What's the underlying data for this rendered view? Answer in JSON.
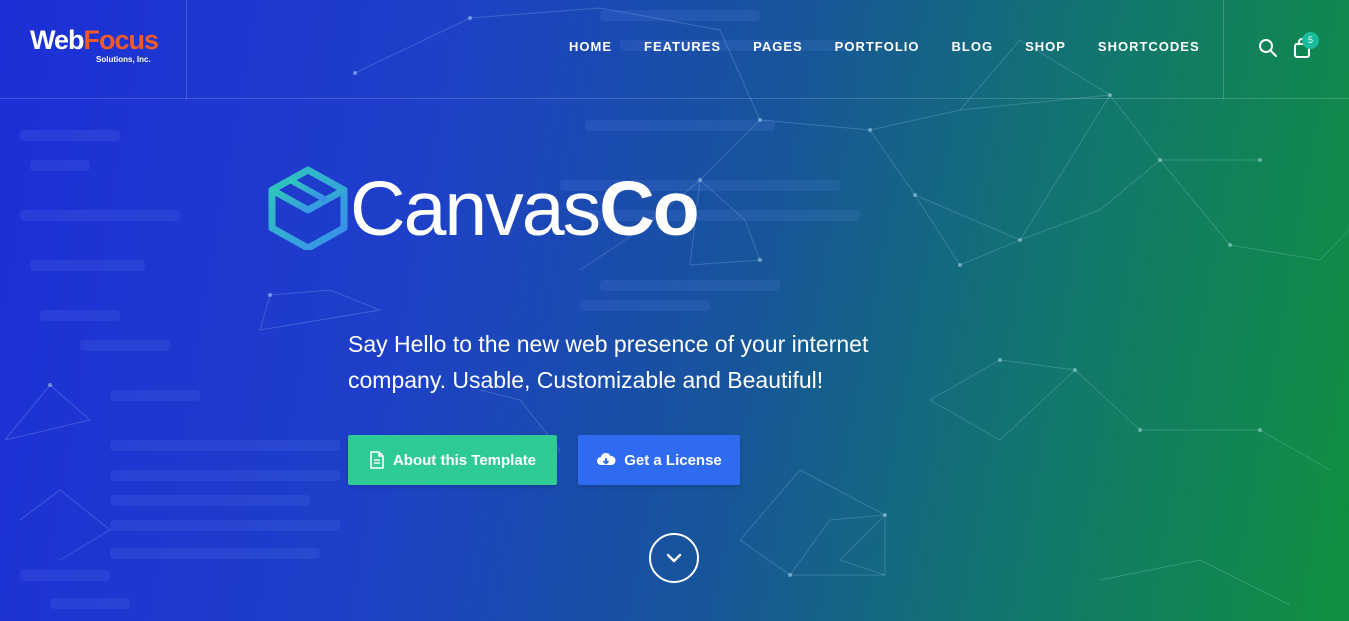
{
  "header": {
    "logo": {
      "word1": "Web",
      "word2": "Focus",
      "subtitle": "Solutions, Inc."
    },
    "nav": [
      {
        "label": "HOME"
      },
      {
        "label": "FEATURES"
      },
      {
        "label": "PAGES"
      },
      {
        "label": "PORTFOLIO"
      },
      {
        "label": "BLOG"
      },
      {
        "label": "SHOP"
      },
      {
        "label": "SHORTCODES"
      }
    ],
    "icons": {
      "search": "search-icon",
      "cart": "shopping-bag-icon"
    },
    "cart_count": "5"
  },
  "hero": {
    "brand": {
      "light": "Canvas",
      "bold": "Co",
      "icon": "cube-logo-icon"
    },
    "tagline_line1": "Say Hello to the new web presence of your internet",
    "tagline_line2": "company. Usable, Customizable and Beautiful!",
    "buttons": {
      "about": {
        "label": "About this Template",
        "icon": "document-icon"
      },
      "license": {
        "label": "Get a License",
        "icon": "cloud-download-icon"
      }
    },
    "scroll_icon": "chevron-down-icon"
  },
  "colors": {
    "gradient_start": "#1c2fd6",
    "gradient_end": "#0f9040",
    "logo_accent": "#f05a28",
    "about_button": "#2ecc94",
    "license_button": "#2f6bf0",
    "badge": "#1abc9c"
  }
}
